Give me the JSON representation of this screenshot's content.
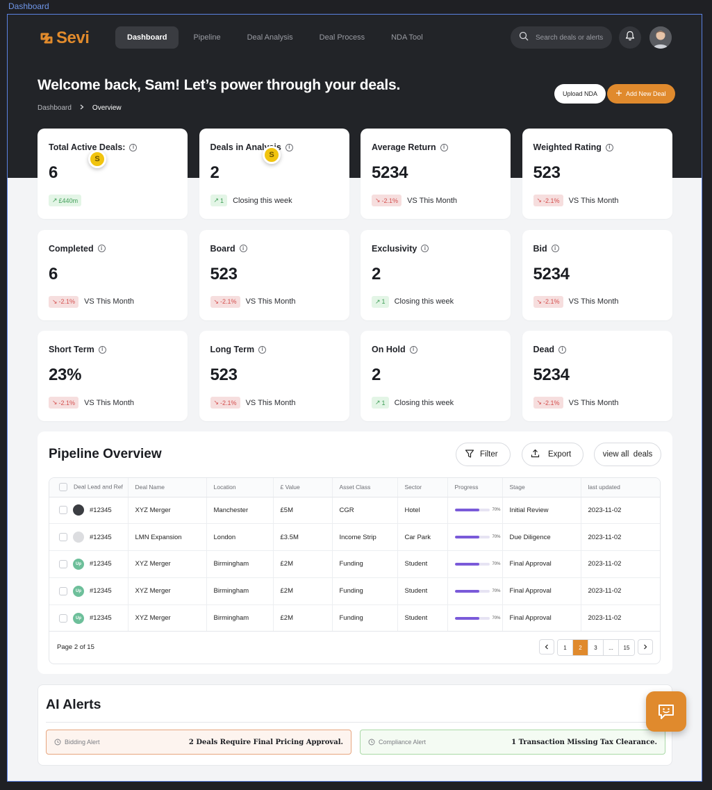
{
  "frame_label": "Dashboard",
  "brand": {
    "name": "Sevi",
    "accent": "#e08a2d"
  },
  "nav": {
    "items": [
      {
        "label": "Dashboard",
        "active": true
      },
      {
        "label": "Pipeline",
        "active": false
      },
      {
        "label": "Deal Analysis",
        "active": false
      },
      {
        "label": "Deal Process",
        "active": false
      },
      {
        "label": "NDA Tool",
        "active": false
      }
    ],
    "search_placeholder": "Search deals or alerts"
  },
  "hero": {
    "title": "Welcome back, Sam! Let’s power through your deals.",
    "breadcrumb": [
      "Dashboard",
      "Overview"
    ],
    "upload_label": "Upload NDA",
    "add_label": "Add New Deal"
  },
  "cards": [
    {
      "title": "Total Active Deals:",
      "value": "6",
      "badge": "£440m",
      "trend": "up",
      "note": ""
    },
    {
      "title": "Deals in Analysis",
      "value": "2",
      "badge": "1",
      "trend": "up",
      "note": "Closing this week"
    },
    {
      "title": "Average Return",
      "value": "5234",
      "badge": "-2.1%",
      "trend": "down",
      "note": "VS This Month"
    },
    {
      "title": "Weighted Rating",
      "value": "523",
      "badge": "-2.1%",
      "trend": "down",
      "note": "VS This Month"
    },
    {
      "title": "Completed",
      "value": "6",
      "badge": "-2.1%",
      "trend": "down",
      "note": "VS This Month"
    },
    {
      "title": "Board",
      "value": "523",
      "badge": "-2.1%",
      "trend": "down",
      "note": "VS This Month"
    },
    {
      "title": "Exclusivity",
      "value": "2",
      "badge": "1",
      "trend": "up",
      "note": "Closing this week"
    },
    {
      "title": "Bid",
      "value": "5234",
      "badge": "-2.1%",
      "trend": "down",
      "note": "VS This Month"
    },
    {
      "title": "Short Term",
      "value": "23%",
      "badge": "-2.1%",
      "trend": "down",
      "note": "VS This Month"
    },
    {
      "title": "Long Term",
      "value": "523",
      "badge": "-2.1%",
      "trend": "down",
      "note": "VS This Month"
    },
    {
      "title": "On Hold",
      "value": "2",
      "badge": "1",
      "trend": "up",
      "note": "Closing this week"
    },
    {
      "title": "Dead",
      "value": "5234",
      "badge": "-2.1%",
      "trend": "down",
      "note": "VS This Month"
    }
  ],
  "coin_letter": "S",
  "pipeline": {
    "title": "Pipeline Overview",
    "filter_label": "Filter",
    "export_label": "Export",
    "view_all_label": "view all  deals",
    "columns": [
      "Deal Lead and Ref",
      "Deal Name",
      "Location",
      "£ Value",
      "Asset Class",
      "Sector",
      "Progress",
      "Stage",
      "last updated"
    ],
    "rows": [
      {
        "avatar": "dark",
        "avatar_text": "",
        "ref": "#12345",
        "name": "XYZ Merger",
        "location": "Manchester",
        "value": "£5M",
        "asset": "CGR",
        "sector": "Hotel",
        "progress": 70,
        "progress_label": "70%",
        "stage": "Initial Review",
        "updated": "2023-11-02"
      },
      {
        "avatar": "light",
        "avatar_text": "",
        "ref": "#12345",
        "name": "LMN Expansion",
        "location": "London",
        "value": "£3.5M",
        "asset": "Income Strip",
        "sector": "Car Park",
        "progress": 70,
        "progress_label": "70%",
        "stage": "Due Diligence",
        "updated": "2023-11-02"
      },
      {
        "avatar": "up",
        "avatar_text": "Up",
        "ref": "#12345",
        "name": "XYZ Merger",
        "location": "Birmingham",
        "value": "£2M",
        "asset": "Funding",
        "sector": "Student",
        "progress": 70,
        "progress_label": "70%",
        "stage": "Final Approval",
        "updated": "2023-11-02"
      },
      {
        "avatar": "up",
        "avatar_text": "Up",
        "ref": "#12345",
        "name": "XYZ Merger",
        "location": "Birmingham",
        "value": "£2M",
        "asset": "Funding",
        "sector": "Student",
        "progress": 70,
        "progress_label": "70%",
        "stage": "Final Approval",
        "updated": "2023-11-02"
      },
      {
        "avatar": "up",
        "avatar_text": "Up",
        "ref": "#12345",
        "name": "XYZ Merger",
        "location": "Birmingham",
        "value": "£2M",
        "asset": "Funding",
        "sector": "Student",
        "progress": 70,
        "progress_label": "70%",
        "stage": "Final Approval",
        "updated": "2023-11-02"
      }
    ],
    "page_info": "Page 2 of 15",
    "pages": [
      "1",
      "2",
      "3",
      "...",
      "15"
    ],
    "active_page": "2"
  },
  "alerts": {
    "title": "AI Alerts",
    "items": [
      {
        "label": "Bidding Alert",
        "message": "2 Deals Require Final Pricing Approval."
      },
      {
        "label": "Compliance Alert",
        "message": "1 Transaction Missing Tax Clearance."
      }
    ]
  }
}
